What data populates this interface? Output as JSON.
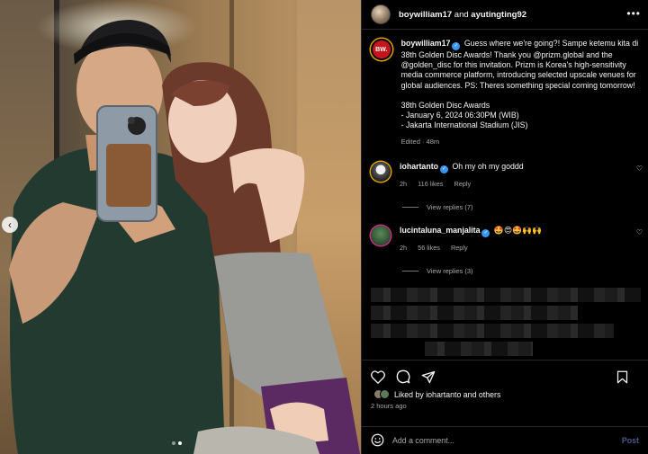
{
  "header": {
    "user1": "boywilliam17",
    "and_text": "and",
    "user2": "ayutingting92",
    "more_icon": "more-horizontal-icon"
  },
  "post": {
    "avatar_text": "BW.",
    "username": "boywilliam17",
    "caption": "Guess where we're going?! Sampe ketemu kita di 38th Golden Disc Awards! Thank you @prizm.global and the @golden_disc for this invitation. Prizm is Korea's high-sensitivity media commerce platform, introducing selected upscale venues for global audiences. PS: Theres something special coming tomorrow!\n\n38th Golden Disc Awards\n- January 6, 2024 06:30PM (WIB)\n- Jakarta International Stadium (JIS)",
    "meta": "Edited · 48m"
  },
  "comments": [
    {
      "username": "iohartanto",
      "text": "Oh my oh my goddd",
      "time": "2h",
      "likes": "116 likes",
      "reply": "Reply",
      "view_replies": "View replies (7)"
    },
    {
      "username": "lucintaluna_manjalita",
      "text": "🤩😍🤩🙌🙌",
      "time": "2h",
      "likes": "56 likes",
      "reply": "Reply",
      "view_replies": "View replies (3)"
    }
  ],
  "liked_by": "Liked by iohartanto and others",
  "time_ago": "2 hours ago",
  "add_comment": {
    "placeholder": "Add a comment...",
    "post_label": "Post"
  },
  "carousel": {
    "total": 2,
    "current": 2
  },
  "colors": {
    "verified": "#3897f0",
    "brand_red": "#c4161c",
    "post_disabled": "#4a5a8a"
  }
}
